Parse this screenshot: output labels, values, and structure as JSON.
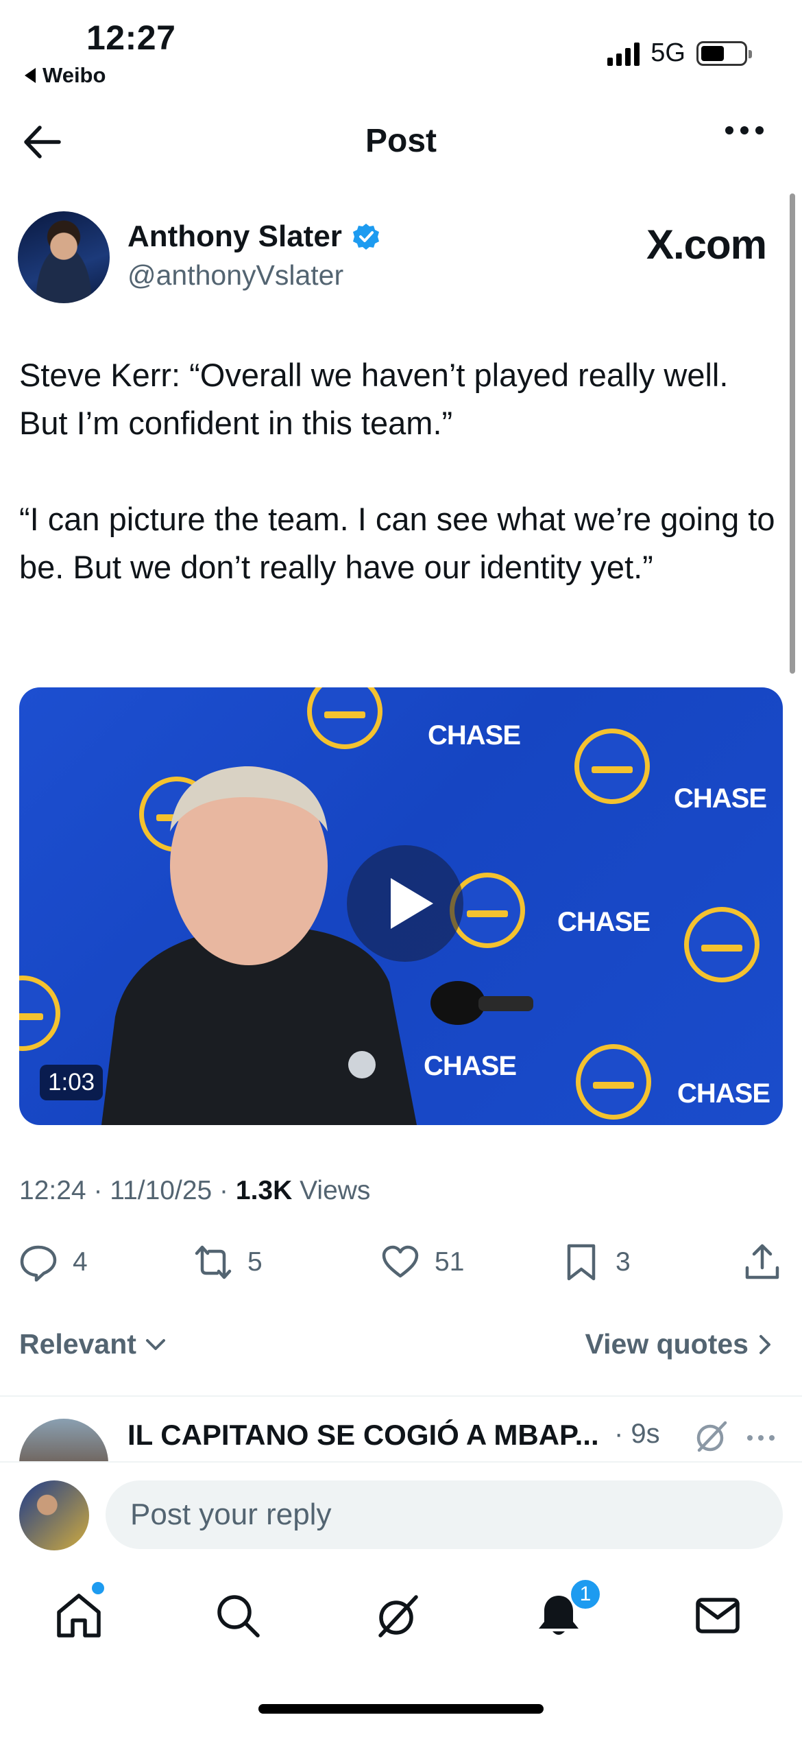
{
  "status_bar": {
    "time": "12:27",
    "back_app": "Weibo",
    "network": "5G",
    "battery_level": 0.55
  },
  "header": {
    "title": "Post"
  },
  "post": {
    "author_name": "Anthony Slater",
    "author_handle": "@anthonyVslater",
    "source_badge": "X.com",
    "paragraph1": "Steve Kerr: “Overall we haven’t played really well. But I’m confident in this team.”",
    "paragraph2": "“I can picture the team. I can see what we’re going to be. But we don’t really have our identity yet.”",
    "video": {
      "duration": "1:03",
      "sponsor_text": "CHASE"
    },
    "meta": {
      "time": "12:24",
      "date": "11/10/25",
      "views_count": "1.3K",
      "views_label": "Views"
    },
    "actions": {
      "replies": "4",
      "reposts": "5",
      "likes": "51",
      "bookmarks": "3"
    }
  },
  "sort": {
    "relevant_label": "Relevant",
    "view_quotes_label": "View quotes"
  },
  "reply_preview": {
    "title": "IL CAPITANO SE COGIÓ A MBAP...",
    "time": "· 9s"
  },
  "composer": {
    "placeholder": "Post your reply"
  },
  "tabbar": {
    "notifications_badge": "1"
  },
  "colors": {
    "accent": "#1d9bf0",
    "muted_text": "#536471",
    "primary_text": "#0f1419",
    "warriors_blue": "#1d4fd0",
    "warriors_gold": "#f4c22f"
  }
}
